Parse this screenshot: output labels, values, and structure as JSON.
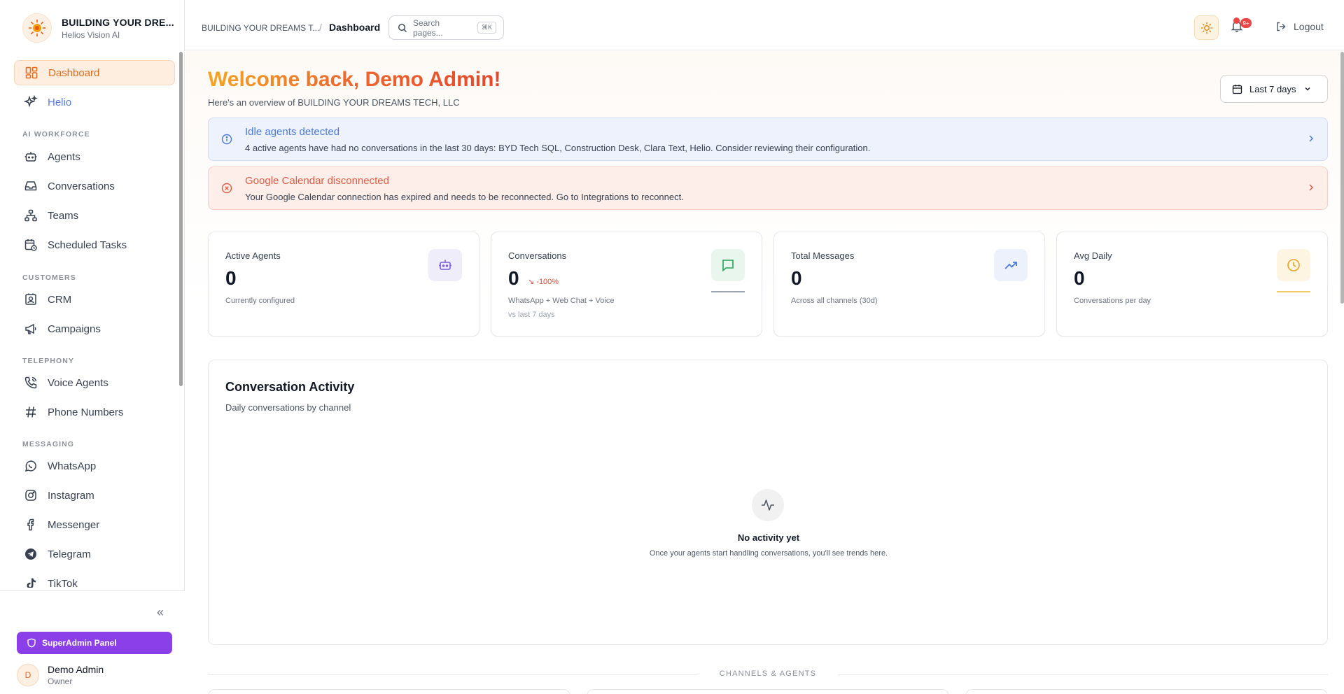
{
  "brand": {
    "title": "BUILDING YOUR DRE...",
    "subtitle": "Helios Vision AI"
  },
  "nav": {
    "dashboard": "Dashboard",
    "helio": "Helio",
    "section_ai": "AI WORKFORCE",
    "agents": "Agents",
    "conversations": "Conversations",
    "teams": "Teams",
    "scheduled": "Scheduled Tasks",
    "section_customers": "CUSTOMERS",
    "crm": "CRM",
    "campaigns": "Campaigns",
    "section_telephony": "TELEPHONY",
    "voice_agents": "Voice Agents",
    "phone_numbers": "Phone Numbers",
    "section_messaging": "MESSAGING",
    "whatsapp": "WhatsApp",
    "instagram": "Instagram",
    "messenger": "Messenger",
    "telegram": "Telegram",
    "tiktok": "TikTok"
  },
  "sidebar_footer": {
    "superadmin": "SuperAdmin Panel",
    "user_initial": "D",
    "user_name": "Demo Admin",
    "user_role": "Owner"
  },
  "header": {
    "breadcrumb_parent": "BUILDING YOUR DREAMS T...",
    "breadcrumb_sep": "/",
    "breadcrumb_current": "Dashboard",
    "search_placeholder": "Search pages...",
    "search_shortcut": "⌘K",
    "notif_badge": "9+",
    "logout": "Logout"
  },
  "main": {
    "welcome": "Welcome back, Demo Admin!",
    "overview": "Here's an overview of BUILDING YOUR DREAMS TECH, LLC",
    "date_range": "Last 7 days"
  },
  "alerts": [
    {
      "title": "Idle agents detected",
      "desc": "4 active agents have had no conversations in the last 30 days: BYD Tech SQL, Construction Desk, Clara Text, Helio. Consider reviewing their configuration."
    },
    {
      "title": "Google Calendar disconnected",
      "desc": "Your Google Calendar connection has expired and needs to be reconnected. Go to Integrations to reconnect."
    }
  ],
  "stats": [
    {
      "label": "Active Agents",
      "value": "0",
      "sub": "Currently configured"
    },
    {
      "label": "Conversations",
      "value": "0",
      "change": "-100%",
      "sub": "WhatsApp + Web Chat + Voice",
      "sub2": "vs last 7 days"
    },
    {
      "label": "Total Messages",
      "value": "0",
      "sub": "Across all channels (30d)"
    },
    {
      "label": "Avg Daily",
      "value": "0",
      "sub": "Conversations per day"
    }
  ],
  "activity": {
    "title": "Conversation Activity",
    "subtitle": "Daily conversations by channel",
    "empty_title": "No activity yet",
    "empty_desc": "Once your agents start handling conversations, you'll see trends here."
  },
  "channels_label": "CHANNELS & AGENTS",
  "colors": {
    "accent": "#ea6a1c",
    "purple": "#8b3fe8",
    "info": "#4a7ae0",
    "error": "#e05d45"
  }
}
